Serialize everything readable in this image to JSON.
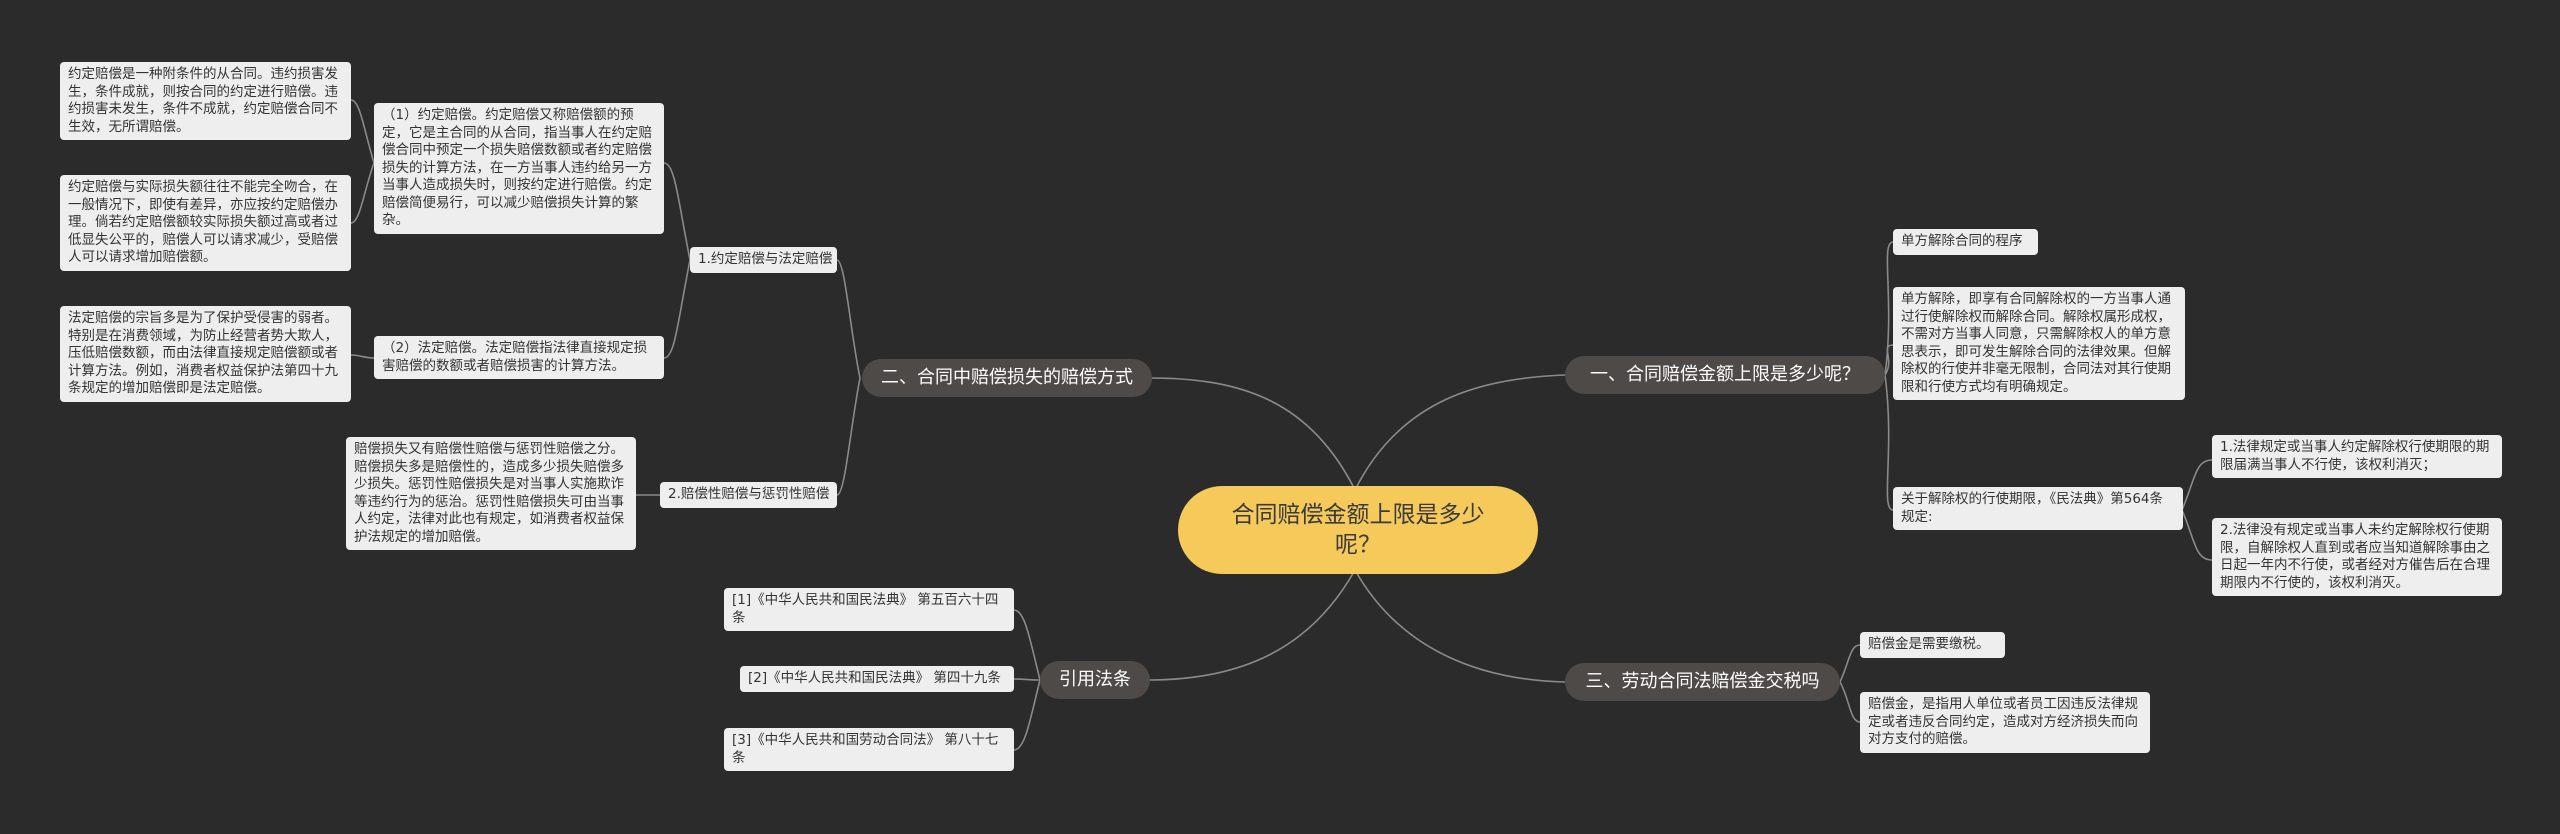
{
  "root": {
    "title": "合同赔偿金额上限是多少呢？"
  },
  "branches": {
    "b1": "一、合同赔偿金额上限是多少呢？",
    "b2": "二、合同中赔偿损失的赔偿方式",
    "b3": "三、劳动合同法赔偿金交税吗",
    "b4": "引用法条"
  },
  "b1_items": {
    "procedure": "单方解除合同的程序",
    "unilateral": "单方解除，即享有合同解除权的一方当事人通过行使解除权而解除合同。解除权属形成权，不需对方当事人同意，只需解除权人的单方意思表示，即可发生解除合同的法律效果。但解除权的行使并非毫无限制，合同法对其行使期限和行使方式均有明确规定。",
    "period": "关于解除权的行使期限，《民法典》第564条规定:",
    "period_1": "1.法律规定或当事人约定解除权行使期限的期限届满当事人不行使，该权利消灭；",
    "period_2": "2.法律没有规定或当事人未约定解除权行使期限，自解除权人直到或者应当知道解除事由之日起一年内不行使，或者经对方催告后在合理期限内不行使的，该权利消灭。"
  },
  "b2_items": {
    "sub1": "1.约定赔偿与法定赔偿",
    "sub1_a": "（1）约定赔偿。约定赔偿又称赔偿额的预定，它是主合同的从合同，指当事人在约定赔偿合同中预定一个损失赔偿数额或者约定赔偿损失的计算方法，在一方当事人违约给另一方当事人造成损失时，则按约定进行赔偿。约定赔偿简便易行，可以减少赔偿损失计算的繁杂。",
    "sub1_a_1": "约定赔偿是一种附条件的从合同。违约损害发生，条件成就，则按合同的约定进行赔偿。违约损害未发生，条件不成就，约定赔偿合同不生效，无所谓赔偿。",
    "sub1_a_2": "约定赔偿与实际损失额往往不能完全吻合，在一般情况下，即使有差异，亦应按约定赔偿办理。倘若约定赔偿额较实际损失额过高或者过低显失公平的，赔偿人可以请求减少，受赔偿人可以请求增加赔偿额。",
    "sub1_b": "（2）法定赔偿。法定赔偿指法律直接规定损害赔偿的数额或者赔偿损害的计算方法。",
    "sub1_b_1": "法定赔偿的宗旨多是为了保护受侵害的弱者。特别是在消费领域，为防止经营者势大欺人，压低赔偿数额，而由法律直接规定赔偿额或者计算方法。例如，消费者权益保护法第四十九条规定的增加赔偿即是法定赔偿。",
    "sub2": "2.赔偿性赔偿与惩罚性赔偿",
    "sub2_a": "赔偿损失又有赔偿性赔偿与惩罚性赔偿之分。赔偿损失多是赔偿性的，造成多少损失赔偿多少损失。惩罚性赔偿损失是对当事人实施欺诈等违约行为的惩治。惩罚性赔偿损失可由当事人约定，法律对此也有规定，如消费者权益保护法规定的增加赔偿。"
  },
  "b3_items": {
    "a": "赔偿金是需要缴税。",
    "b": "赔偿金，是指用人单位或者员工因违反法律规定或者违反合同约定，造成对方经济损失而向对方支付的赔偿。"
  },
  "b4_items": {
    "a": "[1]《中华人民共和国民法典》 第五百六十四条",
    "b": "[2]《中华人民共和国民法典》 第四十九条",
    "c": "[3]《中华人民共和国劳动合同法》 第八十七条"
  }
}
